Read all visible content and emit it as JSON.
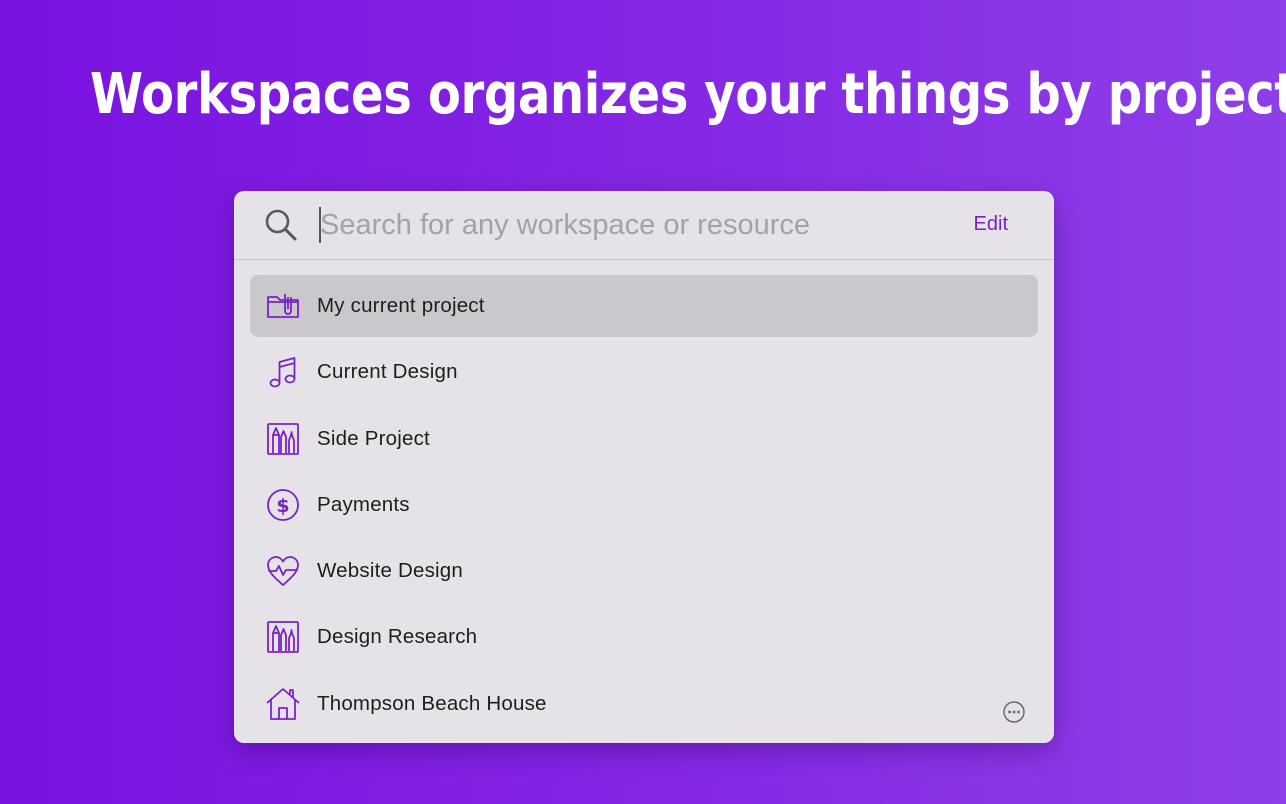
{
  "headline": "Workspaces organizes your things by projects",
  "search": {
    "placeholder": "Search for any workspace or resource",
    "value": "",
    "icon": "search-icon"
  },
  "edit_label": "Edit",
  "accent_color": "#7b22c4",
  "workspaces": [
    {
      "label": "My current project",
      "icon": "folder-clip-icon",
      "selected": true
    },
    {
      "label": "Current Design",
      "icon": "music-note-icon",
      "selected": false
    },
    {
      "label": "Side Project",
      "icon": "art-supplies-icon",
      "selected": false
    },
    {
      "label": "Payments",
      "icon": "dollar-circle-icon",
      "selected": false
    },
    {
      "label": "Website Design",
      "icon": "heart-pulse-icon",
      "selected": false
    },
    {
      "label": "Design Research",
      "icon": "art-supplies-icon",
      "selected": false
    },
    {
      "label": "Thompson Beach House",
      "icon": "house-icon",
      "selected": false
    }
  ],
  "more_icon": "ellipsis-circle-icon"
}
